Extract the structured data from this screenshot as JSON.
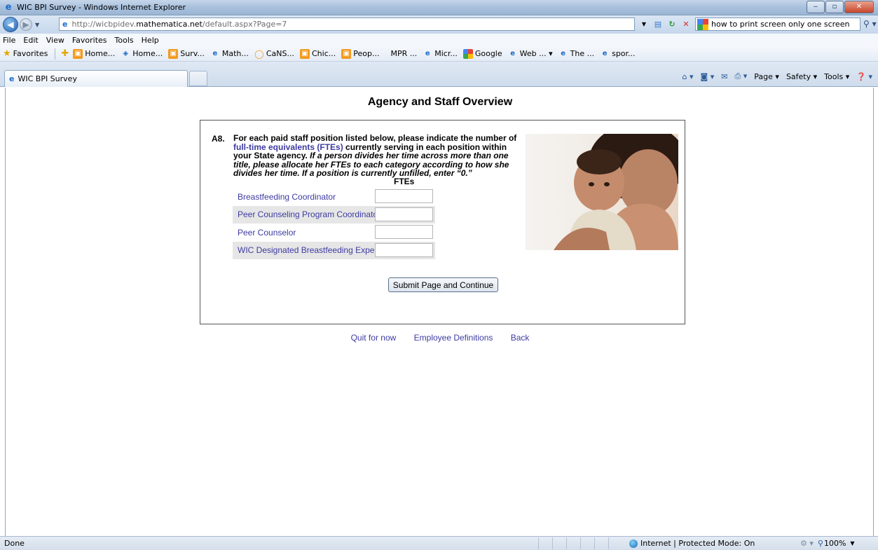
{
  "window": {
    "title": "WIC BPI Survey - Windows Internet Explorer"
  },
  "address_bar": {
    "url_scheme": "http://wicbpidev.",
    "url_host": "mathematica.net",
    "url_path": "/default.aspx?Page=7",
    "search_value": "how to print screen only one screen"
  },
  "menu": [
    "File",
    "Edit",
    "View",
    "Favorites",
    "Tools",
    "Help"
  ],
  "favorites_bar": {
    "label": "Favorites",
    "links": [
      {
        "label": "Home...",
        "icon": "orange-feed-icon"
      },
      {
        "label": "Home...",
        "icon": "globe-icon"
      },
      {
        "label": "Surv...",
        "icon": "orange-feed-icon"
      },
      {
        "label": "Math...",
        "icon": "ie-page-icon"
      },
      {
        "label": "CaNS...",
        "icon": "orange-ring-icon"
      },
      {
        "label": "Chic...",
        "icon": "orange-feed-icon"
      },
      {
        "label": "Peop...",
        "icon": "orange-feed-icon"
      },
      {
        "label": "MPR ...",
        "icon": "none"
      },
      {
        "label": "Micr...",
        "icon": "ie-page-icon"
      },
      {
        "label": "Google",
        "icon": "google-icon"
      },
      {
        "label": "Web ... ▾",
        "icon": "ie-page-icon"
      },
      {
        "label": "The ...",
        "icon": "ie-page-icon"
      },
      {
        "label": "spor...",
        "icon": "ie-page-icon"
      }
    ]
  },
  "tabs": [
    {
      "label": "WIC BPI Survey"
    }
  ],
  "command_bar": {
    "page": "Page ▾",
    "safety": "Safety ▾",
    "tools": "Tools ▾"
  },
  "page": {
    "heading": "Agency and Staff Overview",
    "question_number": "A8.",
    "question_part1": "For each paid staff position listed below, please indicate the number of",
    "question_link": "full-time equivalents (FTEs)",
    "question_part2": "currently serving in each position within your State agency.",
    "question_italic": "If a person divides her time across more than one title, please allocate her FTEs to each category according to how she divides her time. If a position is currently unfilled, enter “0.”",
    "fte_header": "FTEs",
    "rows": [
      {
        "label": "Breastfeeding Coordinator",
        "value": ""
      },
      {
        "label": "Peer Counseling Program Coordinator",
        "value": ""
      },
      {
        "label": "Peer Counselor",
        "value": ""
      },
      {
        "label": "WIC Designated Breastfeeding Expert",
        "value": ""
      }
    ],
    "submit_label": "Submit Page and Continue",
    "footer_links": [
      "Quit for now",
      "Employee Definitions",
      "Back"
    ]
  },
  "status_bar": {
    "status": "Done",
    "zone": "Internet | Protected Mode: On",
    "zoom": "100%"
  }
}
